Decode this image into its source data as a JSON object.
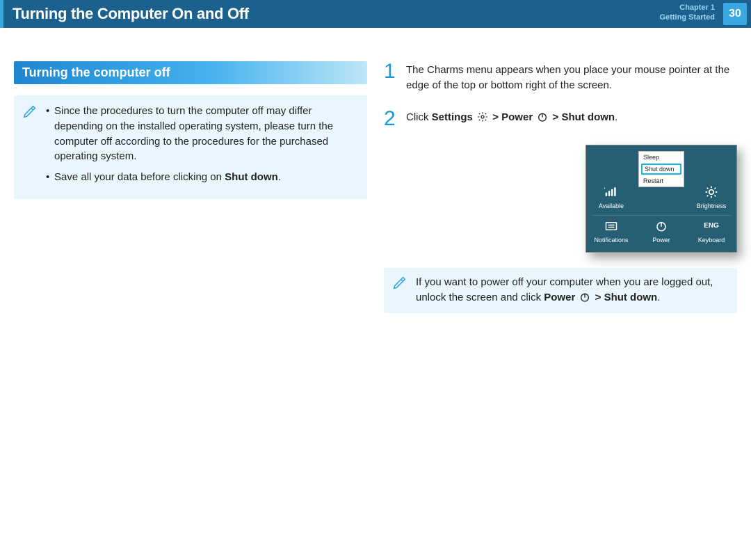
{
  "header": {
    "title": "Turning the Computer On and Off",
    "chapter_line1": "Chapter 1",
    "chapter_line2": "Getting Started",
    "page_number": "30"
  },
  "section": {
    "heading": "Turning the computer off",
    "note_bullet_1": "Since the procedures to turn the computer off may differ depending on the installed operating system, please turn the computer off according to the procedures for the purchased operating system.",
    "note_bullet_2_pre": "Save all your data before clicking on ",
    "note_bullet_2_strong": "Shut down",
    "note_bullet_2_post": "."
  },
  "steps": {
    "s1": {
      "num": "1",
      "text": "The Charms menu appears when you place your mouse pointer at the edge of the top or bottom right of the screen."
    },
    "s2": {
      "num": "2",
      "pre": "Click ",
      "settings": "Settings",
      "gt1": " > ",
      "power": "Power",
      "gt2": " > ",
      "shutdown": "Shut down",
      "post": "."
    }
  },
  "charms": {
    "available": "Available",
    "brightness": "Brightness",
    "notifications": "Notifications",
    "power": "Power",
    "keyboard": "Keyboard",
    "keyboard_lang": "ENG",
    "popup": {
      "sleep": "Sleep",
      "shutdown": "Shut down",
      "restart": "Restart"
    }
  },
  "tip": {
    "pre": "If you want to power off your computer when you are logged out, unlock the screen and click ",
    "power": "Power",
    "gt": " > ",
    "shutdown": "Shut down",
    "post": "."
  }
}
